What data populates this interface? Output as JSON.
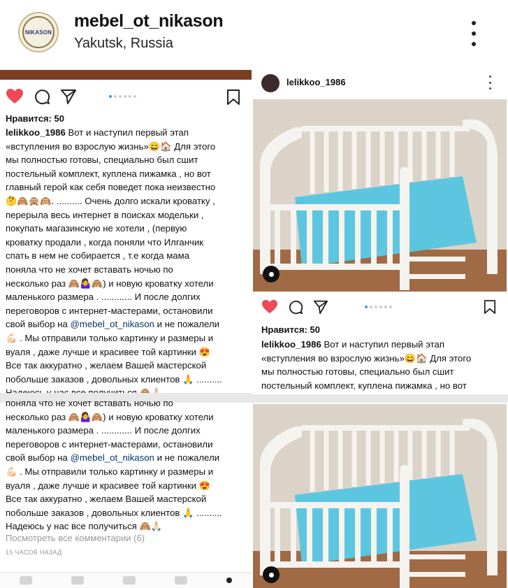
{
  "profile": {
    "username": "mebel_ot_nikason",
    "location": "Yakutsk, Russia",
    "avatar_text": "NIKASON"
  },
  "left_post": {
    "likes": "Нравится: 50",
    "caption_user": "lelikkoo_1986",
    "caption_lines": [
      " Вот и наступил первый этап",
      "«вступления во взрослую жизнь»😄🏠 Для этого",
      "мы полностью готовы, специально был сшит",
      "постельный комплект, куплена пижамка , но вот",
      "главный герой как себя поведет пока неизвестно",
      "🤔🙈🙊🙉. .......... Очень долго искали кроватку ,",
      "перерыла весь интернет  в поисках модельки ,",
      "покупать магазинскую не хотели , (первую",
      "кроватку продали , когда поняли что Илганчик",
      "спать в нем не собирается , т.е когда мама",
      "поняла что не хочет вставать ночью по",
      "несколько раз 🙈🤷‍♀️🙈) и новую кроватку хотели",
      "маленького размера . ............ И после долгих",
      "переговоров с интернет-мастерами, остановили"
    ],
    "caption_mention_prefix": "свой выбор на ",
    "caption_mention": "@mebel_ot_nikason",
    "caption_mention_suffix": " и не пожалели",
    "caption_lines_after": [
      "💪🏻 . Мы отправили только картинку и размеры и",
      "вуаля , даже лучше и красивее той картинки 😍",
      "Все так аккуратно , желаем Вашей мастерской",
      "побольше заказов , довольных клиентов 🙏 ..........",
      "Надеюсь у нас все получиться 🙈🙏🏻"
    ],
    "second_lines": [
      "поняла что не хочет вставать ночью по",
      "несколько раз 🙈🤷‍♀️🙈) и новую кроватку хотели",
      "маленького размера . ............ И после долгих",
      "переговоров с интернет-мастерами, остановили"
    ],
    "second_lines_after": [
      "💪🏻 . Мы отправили только картинку и размеры и",
      "вуаля , даже лучше и красивее той картинки 😍",
      "Все так аккуратно , желаем Вашей мастерской",
      "побольше заказов , довольных клиентов 🙏 ..........",
      "Надеюсь у нас все получиться 🙈🙏🏻"
    ],
    "view_comments": "Посмотреть все комментарии (6)",
    "time_ago": "15 ЧАСОВ НАЗАД"
  },
  "right_post": {
    "username": "lelikkoo_1986",
    "likes": "Нравится: 50",
    "caption_user": "lelikkoo_1986",
    "caption_lines": [
      " Вот и наступил первый этап",
      "«вступления во взрослую жизнь»😄🏠 Для этого",
      "мы полностью готовы, специально был сшит",
      "постельный комплект, куплена пижамка , но вот"
    ]
  },
  "colors": {
    "heart": "#ed4956",
    "mention": "#003569",
    "dot_active": "#3897f0",
    "crib_white": "#f5f3ef",
    "bedding": "#5cc6e0",
    "wall": "#d8cfc3",
    "floor": "#8a5a3a"
  },
  "icons": [
    "heart-icon",
    "comment-icon",
    "share-icon",
    "bookmark-icon",
    "more-icon",
    "user-tag-icon"
  ]
}
